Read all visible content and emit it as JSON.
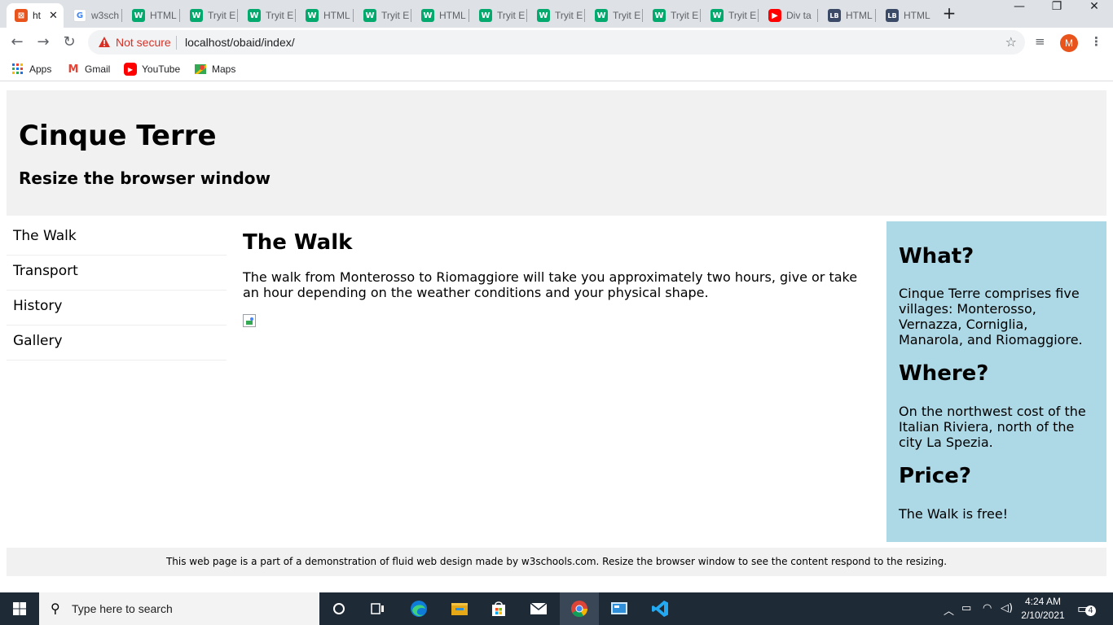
{
  "browser": {
    "tabs": [
      {
        "label": "ht",
        "favicon": "xampp-icon",
        "color": "#e8541c",
        "active": true
      },
      {
        "label": "w3sch",
        "favicon": "google-icon",
        "color": "#ffffff"
      },
      {
        "label": "HTML",
        "favicon": "w3schools-icon",
        "color": "#04aa6d"
      },
      {
        "label": "Tryit E",
        "favicon": "w3schools-icon",
        "color": "#04aa6d"
      },
      {
        "label": "Tryit E",
        "favicon": "w3schools-icon",
        "color": "#04aa6d"
      },
      {
        "label": "HTML",
        "favicon": "w3schools-icon",
        "color": "#04aa6d"
      },
      {
        "label": "Tryit E",
        "favicon": "w3schools-icon",
        "color": "#04aa6d"
      },
      {
        "label": "HTML",
        "favicon": "w3schools-icon",
        "color": "#04aa6d"
      },
      {
        "label": "Tryit E",
        "favicon": "w3schools-icon",
        "color": "#04aa6d"
      },
      {
        "label": "Tryit E",
        "favicon": "w3schools-icon",
        "color": "#04aa6d"
      },
      {
        "label": "Tryit E",
        "favicon": "w3schools-icon",
        "color": "#04aa6d"
      },
      {
        "label": "Tryit E",
        "favicon": "w3schools-icon",
        "color": "#04aa6d"
      },
      {
        "label": "Tryit E",
        "favicon": "w3schools-icon",
        "color": "#04aa6d"
      },
      {
        "label": "Div ta",
        "favicon": "youtube-icon",
        "color": "#ff0000"
      },
      {
        "label": "HTML",
        "favicon": "html-site-icon",
        "color": "#3b4a66"
      },
      {
        "label": "HTML",
        "favicon": "html-site-icon",
        "color": "#3b4a66"
      }
    ],
    "security_label": "Not secure",
    "url": "localhost/obaid/index/",
    "profile_initial": "M",
    "bookmarks": [
      {
        "label": "Apps",
        "icon": "apps-grid-icon"
      },
      {
        "label": "Gmail",
        "icon": "gmail-icon"
      },
      {
        "label": "YouTube",
        "icon": "youtube-icon"
      },
      {
        "label": "Maps",
        "icon": "maps-icon"
      }
    ]
  },
  "page": {
    "header": {
      "title": "Cinque Terre",
      "subtitle": "Resize the browser window"
    },
    "menu": [
      "The Walk",
      "Transport",
      "History",
      "Gallery"
    ],
    "main": {
      "heading": "The Walk",
      "paragraph": "The walk from Monterosso to Riomaggiore will take you approximately two hours, give or take an hour depending on the weather conditions and your physical shape."
    },
    "aside": {
      "sections": [
        {
          "heading": "What?",
          "text": "Cinque Terre comprises five villages: Monterosso, Vernazza, Corniglia, Manarola, and Riomaggiore."
        },
        {
          "heading": "Where?",
          "text": "On the northwest cost of the Italian Riviera, north of the city La Spezia."
        },
        {
          "heading": "Price?",
          "text": "The Walk is free!"
        }
      ]
    },
    "footer": "This web page is a part of a demonstration of fluid web design made by w3schools.com. Resize the browser window to see the content respond to the resizing.",
    "colors": {
      "header_bg": "#f1f1f1",
      "aside_bg": "#add8e6",
      "footer_bg": "#f1f1f1"
    }
  },
  "taskbar": {
    "search_placeholder": "Type here to search",
    "time": "4:24 AM",
    "date": "2/10/2021",
    "notification_count": "4"
  }
}
